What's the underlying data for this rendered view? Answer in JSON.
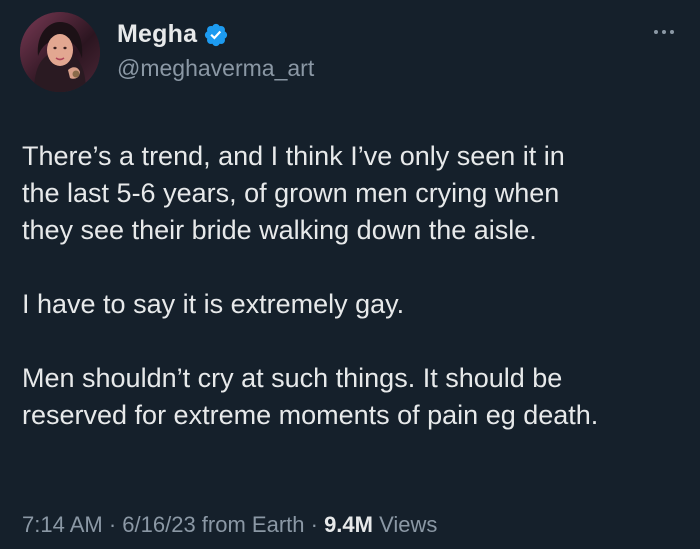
{
  "author": {
    "display_name": "Megha",
    "handle": "@meghaverma_art",
    "verified_icon": "verified-badge-icon",
    "badge_color": "#1d9bf0"
  },
  "menu": {
    "icon": "more-horizontal-icon"
  },
  "tweet": {
    "lines": [
      "There’s a trend, and I think I’ve only seen it in",
      "the last 5-6 years, of grown men crying when",
      "they see their bride walking down the aisle.",
      "",
      "I have to say it is extremely gay.",
      "",
      "Men shouldn’t cry at such things. It should be",
      "reserved for extreme moments of pain eg death."
    ]
  },
  "meta": {
    "time": "7:14 AM",
    "sep1": " · ",
    "date": "6/16/23",
    "source": " from Earth",
    "sep2": " · ",
    "views_count": "9.4M",
    "views_label": " Views"
  },
  "colors": {
    "background": "#15202b",
    "primary_text": "#e7e9ea",
    "secondary_text": "#8b98a5"
  }
}
